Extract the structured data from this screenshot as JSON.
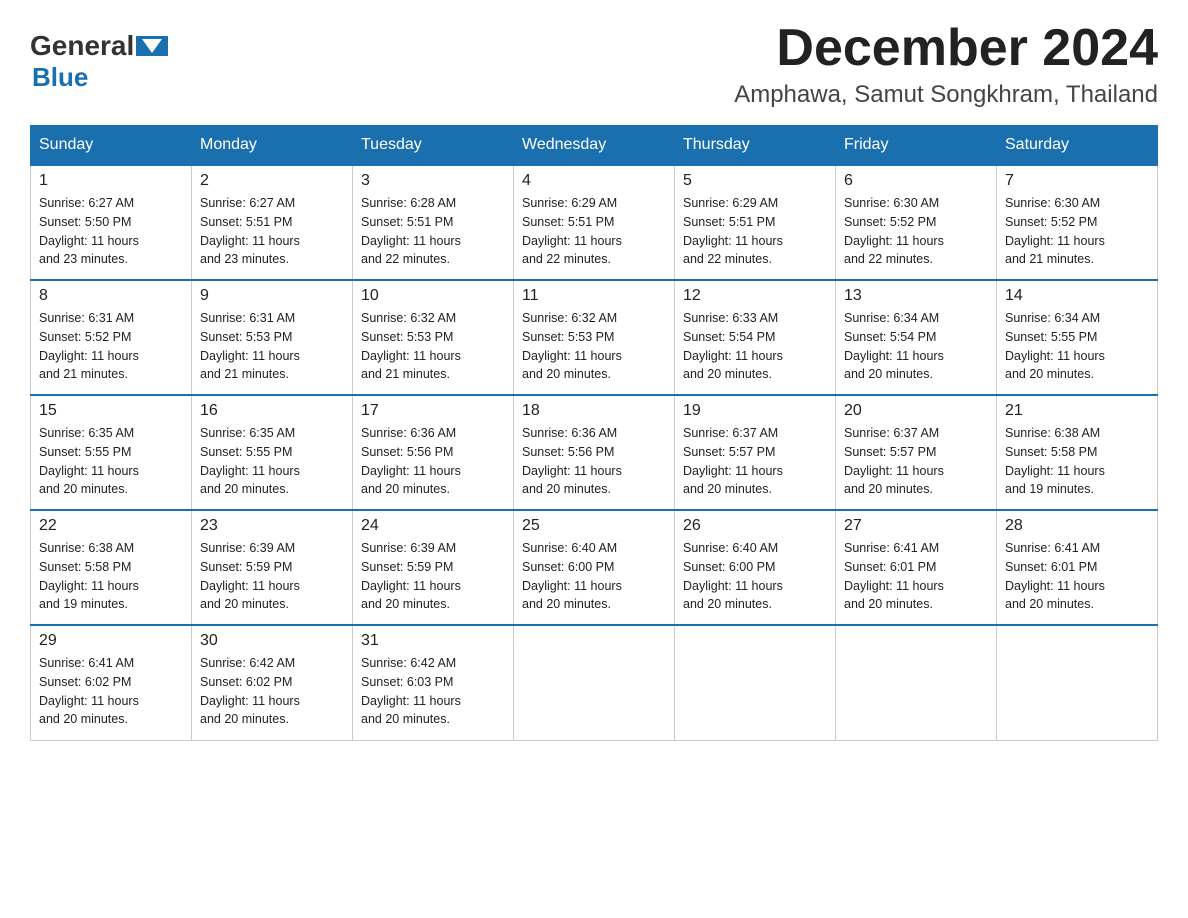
{
  "header": {
    "logo": {
      "general": "General",
      "blue": "Blue"
    },
    "title": "December 2024",
    "location": "Amphawa, Samut Songkhram, Thailand"
  },
  "days_of_week": [
    "Sunday",
    "Monday",
    "Tuesday",
    "Wednesday",
    "Thursday",
    "Friday",
    "Saturday"
  ],
  "weeks": [
    [
      {
        "day": "1",
        "sunrise": "6:27 AM",
        "sunset": "5:50 PM",
        "daylight": "11 hours and 23 minutes."
      },
      {
        "day": "2",
        "sunrise": "6:27 AM",
        "sunset": "5:51 PM",
        "daylight": "11 hours and 23 minutes."
      },
      {
        "day": "3",
        "sunrise": "6:28 AM",
        "sunset": "5:51 PM",
        "daylight": "11 hours and 22 minutes."
      },
      {
        "day": "4",
        "sunrise": "6:29 AM",
        "sunset": "5:51 PM",
        "daylight": "11 hours and 22 minutes."
      },
      {
        "day": "5",
        "sunrise": "6:29 AM",
        "sunset": "5:51 PM",
        "daylight": "11 hours and 22 minutes."
      },
      {
        "day": "6",
        "sunrise": "6:30 AM",
        "sunset": "5:52 PM",
        "daylight": "11 hours and 22 minutes."
      },
      {
        "day": "7",
        "sunrise": "6:30 AM",
        "sunset": "5:52 PM",
        "daylight": "11 hours and 21 minutes."
      }
    ],
    [
      {
        "day": "8",
        "sunrise": "6:31 AM",
        "sunset": "5:52 PM",
        "daylight": "11 hours and 21 minutes."
      },
      {
        "day": "9",
        "sunrise": "6:31 AM",
        "sunset": "5:53 PM",
        "daylight": "11 hours and 21 minutes."
      },
      {
        "day": "10",
        "sunrise": "6:32 AM",
        "sunset": "5:53 PM",
        "daylight": "11 hours and 21 minutes."
      },
      {
        "day": "11",
        "sunrise": "6:32 AM",
        "sunset": "5:53 PM",
        "daylight": "11 hours and 20 minutes."
      },
      {
        "day": "12",
        "sunrise": "6:33 AM",
        "sunset": "5:54 PM",
        "daylight": "11 hours and 20 minutes."
      },
      {
        "day": "13",
        "sunrise": "6:34 AM",
        "sunset": "5:54 PM",
        "daylight": "11 hours and 20 minutes."
      },
      {
        "day": "14",
        "sunrise": "6:34 AM",
        "sunset": "5:55 PM",
        "daylight": "11 hours and 20 minutes."
      }
    ],
    [
      {
        "day": "15",
        "sunrise": "6:35 AM",
        "sunset": "5:55 PM",
        "daylight": "11 hours and 20 minutes."
      },
      {
        "day": "16",
        "sunrise": "6:35 AM",
        "sunset": "5:55 PM",
        "daylight": "11 hours and 20 minutes."
      },
      {
        "day": "17",
        "sunrise": "6:36 AM",
        "sunset": "5:56 PM",
        "daylight": "11 hours and 20 minutes."
      },
      {
        "day": "18",
        "sunrise": "6:36 AM",
        "sunset": "5:56 PM",
        "daylight": "11 hours and 20 minutes."
      },
      {
        "day": "19",
        "sunrise": "6:37 AM",
        "sunset": "5:57 PM",
        "daylight": "11 hours and 20 minutes."
      },
      {
        "day": "20",
        "sunrise": "6:37 AM",
        "sunset": "5:57 PM",
        "daylight": "11 hours and 20 minutes."
      },
      {
        "day": "21",
        "sunrise": "6:38 AM",
        "sunset": "5:58 PM",
        "daylight": "11 hours and 19 minutes."
      }
    ],
    [
      {
        "day": "22",
        "sunrise": "6:38 AM",
        "sunset": "5:58 PM",
        "daylight": "11 hours and 19 minutes."
      },
      {
        "day": "23",
        "sunrise": "6:39 AM",
        "sunset": "5:59 PM",
        "daylight": "11 hours and 20 minutes."
      },
      {
        "day": "24",
        "sunrise": "6:39 AM",
        "sunset": "5:59 PM",
        "daylight": "11 hours and 20 minutes."
      },
      {
        "day": "25",
        "sunrise": "6:40 AM",
        "sunset": "6:00 PM",
        "daylight": "11 hours and 20 minutes."
      },
      {
        "day": "26",
        "sunrise": "6:40 AM",
        "sunset": "6:00 PM",
        "daylight": "11 hours and 20 minutes."
      },
      {
        "day": "27",
        "sunrise": "6:41 AM",
        "sunset": "6:01 PM",
        "daylight": "11 hours and 20 minutes."
      },
      {
        "day": "28",
        "sunrise": "6:41 AM",
        "sunset": "6:01 PM",
        "daylight": "11 hours and 20 minutes."
      }
    ],
    [
      {
        "day": "29",
        "sunrise": "6:41 AM",
        "sunset": "6:02 PM",
        "daylight": "11 hours and 20 minutes."
      },
      {
        "day": "30",
        "sunrise": "6:42 AM",
        "sunset": "6:02 PM",
        "daylight": "11 hours and 20 minutes."
      },
      {
        "day": "31",
        "sunrise": "6:42 AM",
        "sunset": "6:03 PM",
        "daylight": "11 hours and 20 minutes."
      },
      null,
      null,
      null,
      null
    ]
  ],
  "labels": {
    "sunrise": "Sunrise:",
    "sunset": "Sunset:",
    "daylight": "Daylight:"
  }
}
